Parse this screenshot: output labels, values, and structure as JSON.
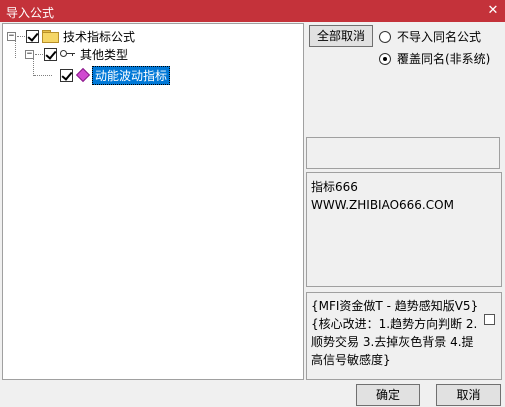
{
  "window": {
    "title": "导入公式",
    "close_glyph": "✕"
  },
  "tree": {
    "root": {
      "label": "技术指标公式",
      "expander": "−",
      "checked": true,
      "icon": "folder-icon"
    },
    "group": {
      "label": "其他类型",
      "expander": "−",
      "checked": true,
      "icon": "key-icon"
    },
    "item": {
      "label": "动能波动指标",
      "checked": true,
      "selected": true,
      "icon": "formula-gem-icon"
    }
  },
  "controls": {
    "uncheck_all_label": "全部取消",
    "options": [
      {
        "label": "不导入同名公式",
        "selected": false
      },
      {
        "label": "覆盖同名(非系统)",
        "selected": true
      }
    ]
  },
  "description": {
    "lines": [
      "指标666",
      "WWW.ZHIBIAO666.COM"
    ]
  },
  "note": {
    "text": "{MFI资金做T - 趋势感知版V5} {核心改进：1.趋势方向判断 2.顺势交易 3.去掉灰色背景 4.提高信号敏感度}",
    "checked": false
  },
  "footer": {
    "ok_label": "确定",
    "cancel_label": "取消"
  },
  "colors": {
    "titlebar": "#c4323a",
    "selection": "#0078d7",
    "folder": "#f5d666",
    "gem": "#d04ad0"
  }
}
